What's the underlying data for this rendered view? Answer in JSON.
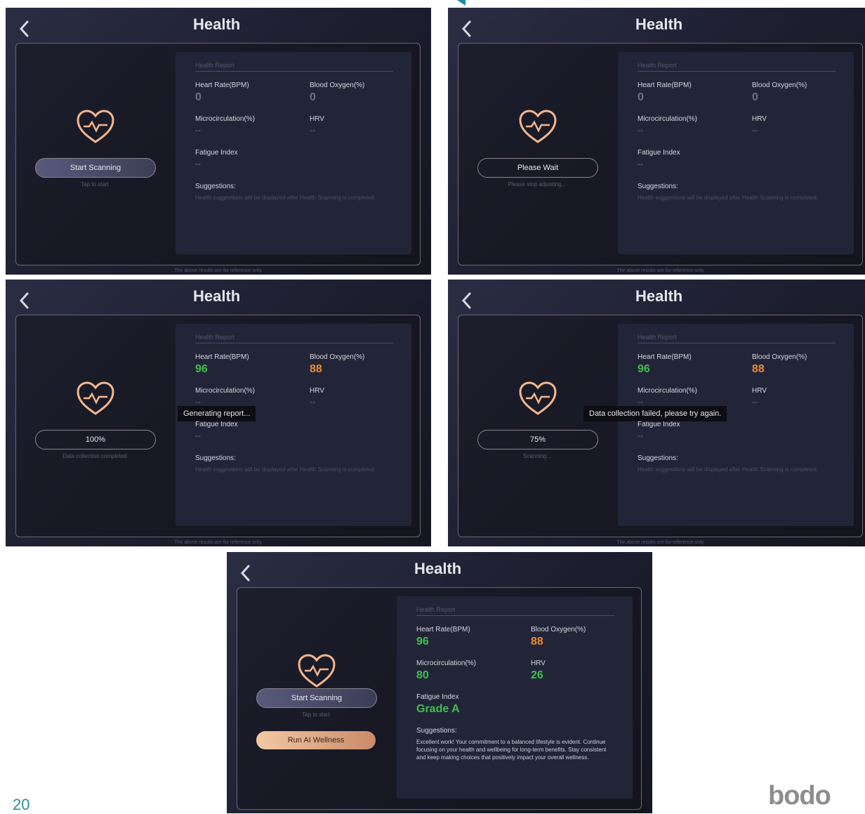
{
  "common": {
    "title": "Health",
    "report_title": "Health Report",
    "heart_rate_label": "Heart Rate(BPM)",
    "blood_oxygen_label": "Blood Oxygen(%)",
    "micro_label": "Microcirculation(%)",
    "hrv_label": "HRV",
    "fatigue_label": "Fatigue Index",
    "suggestions_label": "Suggestions:",
    "suggestion_placeholder": "Health suggestions will be displayed after Health Scanning is completed.",
    "footer": "The above results are for reference only.",
    "dash": "--"
  },
  "screens": [
    {
      "button": "Start Scanning",
      "hint": "Tap to start",
      "heart_rate": "0",
      "blood_oxygen": "0",
      "micro": "--",
      "hrv": "--",
      "fatigue": "--"
    },
    {
      "button": "Please Wait",
      "hint": "Please stop adjusting...",
      "heart_rate": "0",
      "blood_oxygen": "0",
      "micro": "--",
      "hrv": "--",
      "fatigue": "--"
    },
    {
      "button": "100%",
      "hint": "Data collection completed",
      "heart_rate": "96",
      "blood_oxygen": "88",
      "micro": "--",
      "hrv": "--",
      "fatigue": "--",
      "toast": "Generating report..."
    },
    {
      "button": "75%",
      "hint": "Scanning...",
      "heart_rate": "96",
      "blood_oxygen": "88",
      "micro": "--",
      "hrv": "--",
      "fatigue": "--",
      "toast": "Data collection failed, please try again."
    },
    {
      "button": "Start Scanning",
      "hint": "Tap to start",
      "ai_button": "Run AI Wellness",
      "heart_rate": "96",
      "blood_oxygen": "88",
      "micro": "80",
      "hrv": "26",
      "fatigue": "Grade A",
      "suggestion": "Excellent work! Your commitment to a balanced lifestyle is evident. Continue focusing on your health and wellbeing for long-term benefits. Stay consistent and keep making choices that positively impact your overall wellness."
    }
  ],
  "page_number": "20",
  "logo": "bodo",
  "colors": {
    "good": "#3fc04a",
    "warn": "#f08a2e",
    "accent": "#c98a69"
  },
  "icons": {
    "back": "chevron-left-icon",
    "heart": "heart-pulse-icon"
  }
}
